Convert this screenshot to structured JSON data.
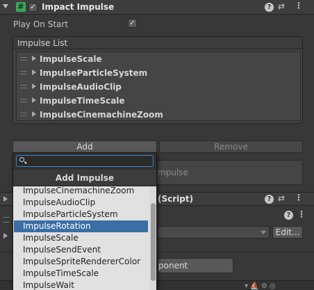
{
  "component": {
    "title": "Impact Impulse",
    "icon": "script-hash-icon",
    "enabled_check": "✓"
  },
  "play_on_start": {
    "label": "Play On Start",
    "check": "✓"
  },
  "impulse_list": {
    "header": "Impulse List",
    "items": [
      "ImpulseScale",
      "ImpulseParticleSystem",
      "ImpulseAudioClip",
      "ImpulseTimeScale",
      "ImpulseCinemachineZoom"
    ]
  },
  "buttons": {
    "add": "Add",
    "remove": "Remove"
  },
  "behind": {
    "impulse_fragment": "mpulse",
    "script_fragment": "(Script)",
    "edit_label": "Edit...",
    "component_fragment": "ponent"
  },
  "popup": {
    "search_value": "",
    "title": "Add Impulse",
    "items": [
      "ImpulseCinemachineZoom",
      "ImpulseAudioClip",
      "ImpulseParticleSystem",
      "ImpulseRotation",
      "ImpulseScale",
      "ImpulseSendEvent",
      "ImpulseSpriteRendererColor",
      "ImpulseTimeScale",
      "ImpulseWait"
    ],
    "selected_index": 3
  },
  "colors": {
    "selection": "#3a6ea5",
    "script_icon": "#3ba55c",
    "search_focus": "#3d88c8"
  }
}
